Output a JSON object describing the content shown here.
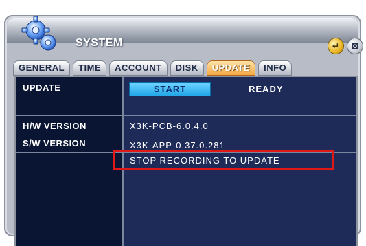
{
  "window": {
    "title": "SYSTEM"
  },
  "title_controls": [
    {
      "name": "enter-icon",
      "glyph": "↵"
    },
    {
      "name": "close-icon",
      "glyph": "⊠"
    }
  ],
  "tabs": [
    {
      "label": "GENERAL",
      "active": false
    },
    {
      "label": "TIME",
      "active": false
    },
    {
      "label": "ACCOUNT",
      "active": false
    },
    {
      "label": "DISK",
      "active": false
    },
    {
      "label": "UPDATE",
      "active": true
    },
    {
      "label": "INFO",
      "active": false
    }
  ],
  "update": {
    "label": "UPDATE",
    "start_button": "START",
    "status": "READY"
  },
  "hw": {
    "label": "H/W VERSION",
    "value": "X3K-PCB-6.0.4.0"
  },
  "sw": {
    "label": "S/W VERSION",
    "value": "X3K-APP-0.37.0.281"
  },
  "message": "STOP RECORDING TO UPDATE",
  "colors": {
    "panel": "#1e2b58",
    "label_column": "#0a1533",
    "active_tab": "#f4a844",
    "start_button": "#23a6e8",
    "highlight": "#e01818"
  }
}
